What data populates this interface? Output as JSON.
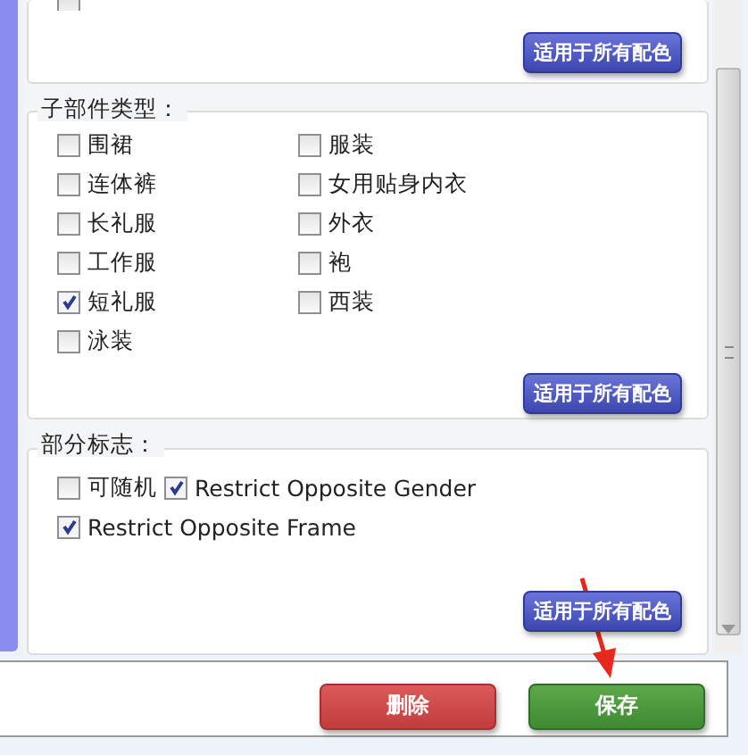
{
  "top_section": {
    "partial_item": {
      "checked": false
    },
    "apply_button": "适用于所有配色"
  },
  "subpart_types": {
    "legend": "子部件类型：",
    "items": [
      {
        "label": "围裙",
        "checked": false
      },
      {
        "label": "服装",
        "checked": false
      },
      {
        "label": "连体裤",
        "checked": false
      },
      {
        "label": "女用贴身内衣",
        "checked": false
      },
      {
        "label": "长礼服",
        "checked": false
      },
      {
        "label": "外衣",
        "checked": false
      },
      {
        "label": "工作服",
        "checked": false
      },
      {
        "label": "袍",
        "checked": false
      },
      {
        "label": "短礼服",
        "checked": true
      },
      {
        "label": "西装",
        "checked": false
      },
      {
        "label": "泳装",
        "checked": false
      }
    ],
    "apply_button": "适用于所有配色"
  },
  "part_flags": {
    "legend": "部分标志：",
    "rows": [
      [
        {
          "label": "可随机",
          "checked": false
        },
        {
          "label": "Restrict Opposite Gender",
          "checked": true
        }
      ],
      [
        {
          "label": "Restrict Opposite Frame",
          "checked": true
        }
      ]
    ],
    "apply_button": "适用于所有配色"
  },
  "footer": {
    "buttons": [
      {
        "label": "删除",
        "kind": "danger"
      },
      {
        "label": "保存",
        "kind": "primary"
      }
    ]
  }
}
